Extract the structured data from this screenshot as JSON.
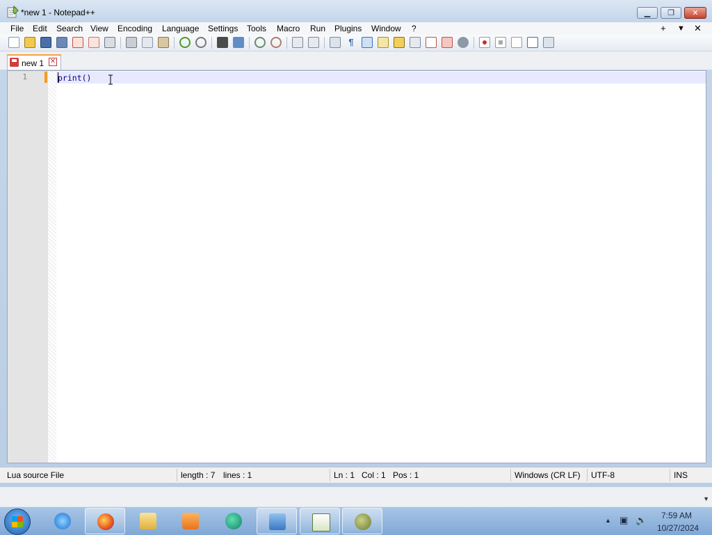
{
  "window": {
    "title": "*new 1 - Notepad++",
    "controls": [
      "minimize",
      "maximize",
      "close"
    ]
  },
  "menu": {
    "items": [
      "File",
      "Edit",
      "Search",
      "View",
      "Encoding",
      "Language",
      "Settings",
      "Tools",
      "Macro",
      "Run",
      "Plugins",
      "Window",
      "?"
    ],
    "right_controls": [
      "+",
      "▼",
      "✕"
    ]
  },
  "toolbar": {
    "icons": [
      "new-file-icon",
      "open-file-icon",
      "save-icon",
      "save-all-icon",
      "close-icon",
      "close-all-icon",
      "print-icon",
      "cut-icon",
      "copy-icon",
      "paste-icon",
      "undo-icon",
      "redo-icon",
      "find-icon",
      "replace-icon",
      "zoom-in-icon",
      "zoom-out-icon",
      "sync-vertical-icon",
      "sync-horizontal-icon",
      "word-wrap-icon",
      "show-all-chars-icon",
      "indent-guide-icon",
      "doc-map-icon",
      "function-list-icon",
      "folder-as-workspace-icon",
      "monitoring-icon",
      "record-macro-icon",
      "stop-macro-icon",
      "play-macro-icon",
      "run-macro-multiple-icon",
      "save-macro-icon"
    ]
  },
  "tab": {
    "label": "new 1",
    "close_glyph": "✕"
  },
  "editor": {
    "line_number": "1",
    "code": "print()"
  },
  "statusbar": {
    "language": "Lua source File",
    "length": "length : 7",
    "lines": "lines : 1",
    "ln": "Ln : 1",
    "col": "Col : 1",
    "pos": "Pos : 1",
    "eol": "Windows (CR LF)",
    "encoding": "UTF-8",
    "mode": "INS"
  },
  "taskbar": {
    "apps": [
      "internet-explorer-icon",
      "firefox-icon",
      "file-explorer-icon",
      "media-player-icon",
      "app-green-icon",
      "control-panel-icon",
      "notepadpp-icon",
      "gimp-icon"
    ],
    "clock_time": "7:59 AM",
    "clock_date": "10/27/2024"
  },
  "colors": {
    "accent_tab": "#f7a33b",
    "code_text": "#000080",
    "current_line": "#e8e8ff"
  }
}
